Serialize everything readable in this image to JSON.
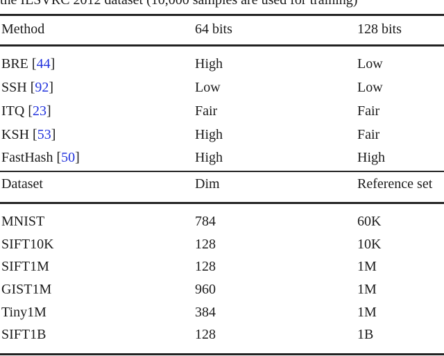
{
  "caption": "the ILSVRC 2012 dataset (10,000 samples are used for training)",
  "table1": {
    "headers": [
      "Method",
      "64 bits",
      "128 bits"
    ],
    "rows": [
      {
        "method": "BRE ",
        "cite": "44",
        "b64": "High",
        "b128": "Low"
      },
      {
        "method": "SSH ",
        "cite": "92",
        "b64": "Low",
        "b128": "Low"
      },
      {
        "method": "ITQ ",
        "cite": "23",
        "b64": "Fair",
        "b128": "Fair"
      },
      {
        "method": "KSH ",
        "cite": "53",
        "b64": "High",
        "b128": "Fair"
      },
      {
        "method": "FastHash ",
        "cite": "50",
        "b64": "High",
        "b128": "High"
      }
    ]
  },
  "table2": {
    "headers": [
      "Dataset",
      "Dim",
      "Reference set"
    ],
    "rows": [
      {
        "dataset": "MNIST",
        "dim": "784",
        "ref": "60K"
      },
      {
        "dataset": "SIFT10K",
        "dim": "128",
        "ref": "10K"
      },
      {
        "dataset": "SIFT1M",
        "dim": "128",
        "ref": "1M"
      },
      {
        "dataset": "GIST1M",
        "dim": "960",
        "ref": "1M"
      },
      {
        "dataset": "Tiny1M",
        "dim": "384",
        "ref": "1M"
      },
      {
        "dataset": "SIFT1B",
        "dim": "128",
        "ref": "1B"
      }
    ]
  },
  "colors": {
    "citation": "#2233dd",
    "text": "#1a1a1a",
    "rule": "#222222"
  }
}
